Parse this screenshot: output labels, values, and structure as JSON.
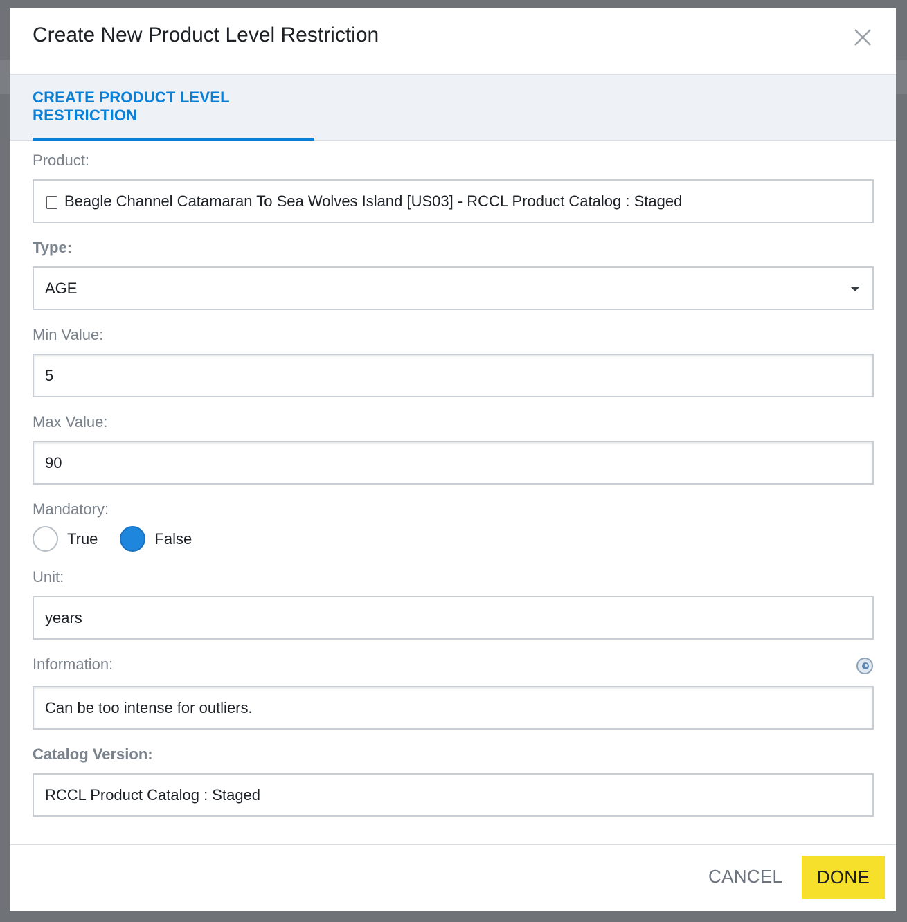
{
  "dialog": {
    "title": "Create New Product Level Restriction",
    "tab_label": "CREATE PRODUCT LEVEL RESTRICTION"
  },
  "form": {
    "product": {
      "label": "Product:",
      "value": "Beagle Channel Catamaran To Sea Wolves Island [US03] - RCCL Product Catalog : Staged"
    },
    "type": {
      "label": "Type:",
      "value": "AGE"
    },
    "min_value": {
      "label": "Min Value:",
      "value": "5"
    },
    "max_value": {
      "label": "Max Value:",
      "value": "90"
    },
    "mandatory": {
      "label": "Mandatory:",
      "options": [
        "True",
        "False"
      ],
      "selected": "False"
    },
    "unit": {
      "label": "Unit:",
      "value": "years"
    },
    "information": {
      "label": "Information:",
      "value": "Can be too intense for outliers."
    },
    "catalog_version": {
      "label": "Catalog Version:",
      "value": "RCCL Product Catalog : Staged"
    }
  },
  "footer": {
    "cancel_label": "CANCEL",
    "done_label": "DONE"
  },
  "colors": {
    "accent": "#0a7fd6",
    "done_button": "#f7e02b",
    "radio_checked": "#1f86dd"
  }
}
